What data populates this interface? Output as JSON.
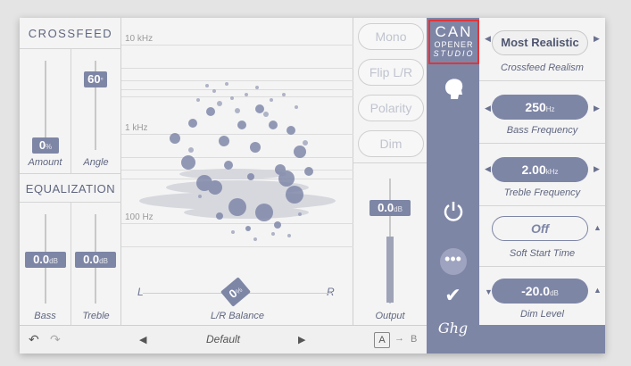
{
  "crossfeed": {
    "title": "CROSSFEED",
    "amount": {
      "value": "0",
      "unit": "%",
      "label": "Amount"
    },
    "angle": {
      "value": "60",
      "unit": "°",
      "label": "Angle"
    }
  },
  "equalization": {
    "title": "EQUALIZATION",
    "bass": {
      "value": "0.0",
      "unit": "dB",
      "label": "Bass"
    },
    "treble": {
      "value": "0.0",
      "unit": "dB",
      "label": "Treble"
    }
  },
  "visualizer": {
    "freq_labels": [
      "10 kHz",
      "1 kHz",
      "100 Hz"
    ],
    "balance": {
      "left": "L",
      "right": "R",
      "value": "0",
      "unit": "%",
      "label": "L/R Balance"
    }
  },
  "toggles": [
    "Mono",
    "Flip L/R",
    "Polarity",
    "Dim"
  ],
  "output": {
    "value": "0.0",
    "unit": "dB",
    "label": "Output"
  },
  "logo": {
    "line1": "CAN",
    "line2": "OPENER",
    "line3": "STUDIO"
  },
  "strip_icons": {
    "head": "head-icon",
    "power": "power-icon",
    "more": "more-icon",
    "check": "check-icon",
    "brand": "Ghg"
  },
  "right": {
    "realism": {
      "value": "Most Realistic",
      "label": "Crossfeed Realism"
    },
    "bass_freq": {
      "value": "250",
      "unit": "Hz",
      "label": "Bass Frequency"
    },
    "treble_freq": {
      "value": "2.00",
      "unit": "kHz",
      "label": "Treble Frequency"
    },
    "soft_start": {
      "value": "Off",
      "label": "Soft Start Time"
    },
    "dim_level": {
      "value": "-20.0",
      "unit": "dB",
      "label": "Dim Level"
    }
  },
  "bottom": {
    "preset": "Default",
    "ab_a": "A",
    "ab_b": "B",
    "undo_icon": "undo-icon",
    "redo_icon": "redo-icon"
  },
  "colors": {
    "accent": "#7e86a6",
    "logo_border": "#e0353a",
    "background": "#f4f4f4"
  }
}
